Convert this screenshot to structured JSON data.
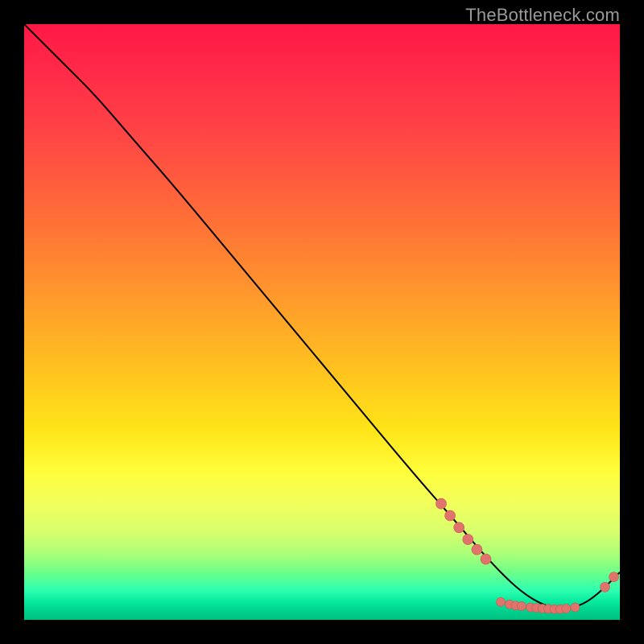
{
  "watermark": "TheBottleneck.com",
  "colors": {
    "curve": "#000000",
    "marker_fill": "#e0736b",
    "marker_stroke": "#c85a54"
  },
  "chart_data": {
    "type": "line",
    "title": "",
    "xlabel": "",
    "ylabel": "",
    "xlim": [
      0,
      100
    ],
    "ylim": [
      0,
      100
    ],
    "grid": false,
    "legend": false,
    "series": [
      {
        "name": "curve",
        "x": [
          0,
          3,
          7,
          12,
          18,
          25,
          35,
          45,
          55,
          65,
          72,
          78,
          83,
          87,
          90,
          93,
          96,
          100
        ],
        "y": [
          100,
          97,
          93,
          88,
          81,
          73,
          61,
          49,
          37,
          25,
          17,
          10,
          5,
          2.5,
          1.8,
          2.2,
          4,
          8
        ]
      }
    ],
    "markers_mid": [
      {
        "x": 70,
        "y": 19.5
      },
      {
        "x": 71.5,
        "y": 17.5
      },
      {
        "x": 73,
        "y": 15.5
      },
      {
        "x": 74.5,
        "y": 13.5
      },
      {
        "x": 76,
        "y": 11.8
      },
      {
        "x": 77.5,
        "y": 10.2
      }
    ],
    "markers_bottom": [
      {
        "x": 80,
        "y": 3.0
      },
      {
        "x": 81.5,
        "y": 2.6
      },
      {
        "x": 82.5,
        "y": 2.4
      },
      {
        "x": 83.5,
        "y": 2.3
      },
      {
        "x": 85,
        "y": 2.1
      },
      {
        "x": 86,
        "y": 2.0
      },
      {
        "x": 87,
        "y": 1.9
      },
      {
        "x": 88,
        "y": 1.85
      },
      {
        "x": 89,
        "y": 1.8
      },
      {
        "x": 90,
        "y": 1.8
      },
      {
        "x": 91,
        "y": 1.9
      },
      {
        "x": 92.5,
        "y": 2.1
      }
    ],
    "markers_tail": [
      {
        "x": 97.5,
        "y": 5.5
      },
      {
        "x": 99,
        "y": 7.2
      }
    ]
  }
}
